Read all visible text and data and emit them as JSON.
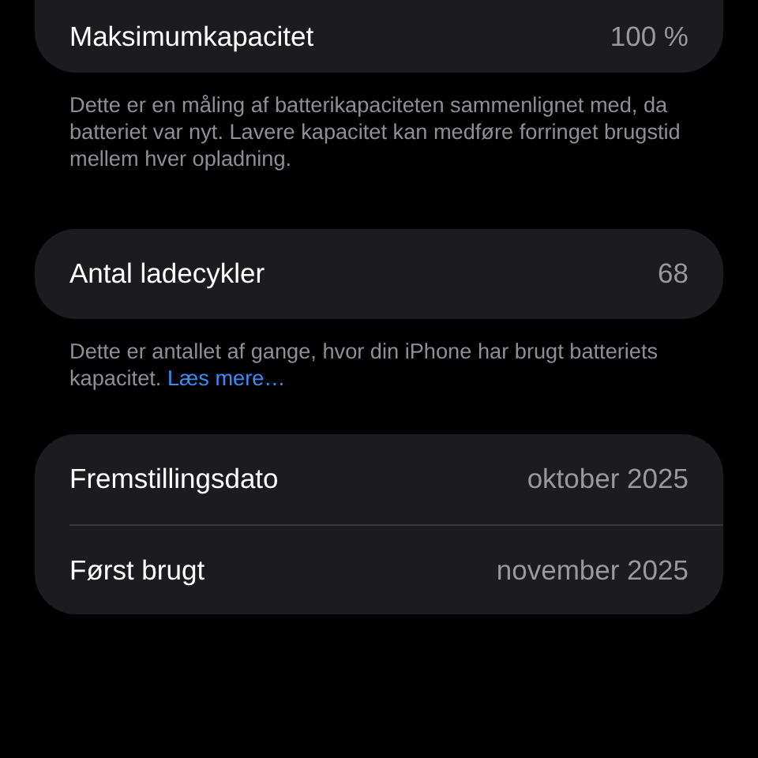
{
  "sections": [
    {
      "rows": [
        {
          "label": "Maksimumkapacitet",
          "value": "100 %"
        }
      ],
      "footer": {
        "text": "Dette er en måling af batterikapaciteten sammenlignet med, da batteriet var nyt. Lavere kapacitet kan medføre forringet brugstid mellem hver opladning."
      }
    },
    {
      "rows": [
        {
          "label": "Antal ladecykler",
          "value": "68"
        }
      ],
      "footer": {
        "text": "Dette er antallet af gange, hvor din iPhone har brugt batteriets kapacitet.",
        "link": "Læs mere…"
      }
    },
    {
      "rows": [
        {
          "label": "Fremstillingsdato",
          "value": "oktober 2025"
        },
        {
          "label": "Først brugt",
          "value": "november 2025"
        }
      ]
    }
  ]
}
